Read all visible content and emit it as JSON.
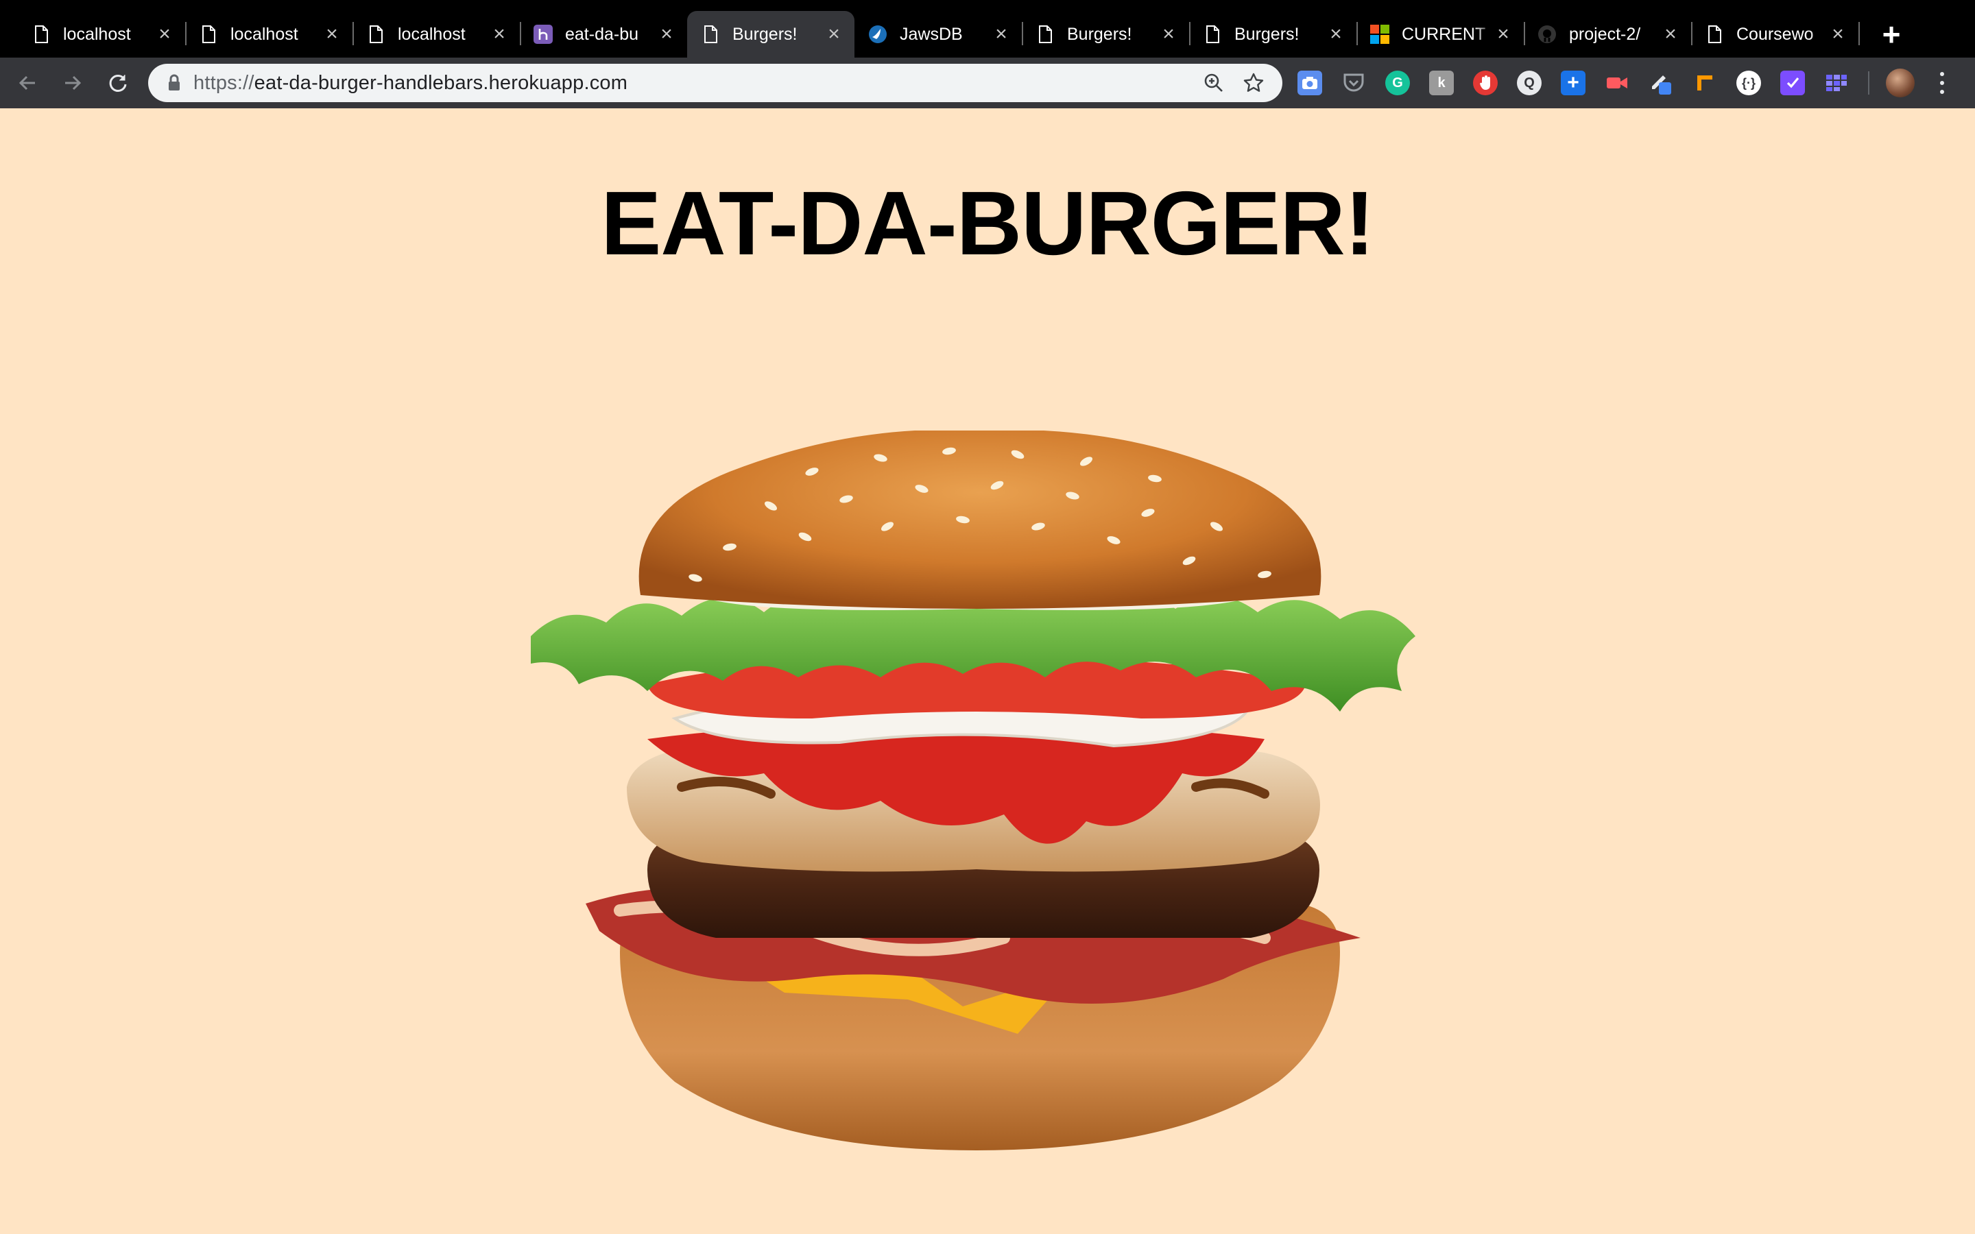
{
  "browser": {
    "tabs": [
      {
        "title": "localhost",
        "favicon": "page-icon",
        "active": false
      },
      {
        "title": "localhost",
        "favicon": "page-icon",
        "active": false
      },
      {
        "title": "localhost",
        "favicon": "page-icon",
        "active": false
      },
      {
        "title": "eat-da-bu",
        "favicon": "heroku-icon",
        "active": false
      },
      {
        "title": "Burgers!",
        "favicon": "page-icon",
        "active": true
      },
      {
        "title": "JawsDB",
        "favicon": "jawsdb-icon",
        "active": false
      },
      {
        "title": "Burgers!",
        "favicon": "page-icon",
        "active": false
      },
      {
        "title": "Burgers!",
        "favicon": "page-icon",
        "active": false
      },
      {
        "title": "CURRENT",
        "favicon": "microsoft-icon",
        "active": false
      },
      {
        "title": "project-2/",
        "favicon": "github-icon",
        "active": false
      },
      {
        "title": "Coursewo",
        "favicon": "page-icon",
        "active": false
      }
    ],
    "address": {
      "scheme": "https://",
      "host": "eat-da-burger-handlebars.herokuapp.com"
    },
    "extensions": [
      {
        "name": "screenshot-extension-icon",
        "color": "#5b8def"
      },
      {
        "name": "pocket-icon",
        "color": "#9aa0a6"
      },
      {
        "name": "grammarly-icon",
        "color": "#15c39a"
      },
      {
        "name": "extension-k-icon",
        "color": "#8a8a8a"
      },
      {
        "name": "stop-hand-icon",
        "color": "#e53935"
      },
      {
        "name": "extension-q-icon",
        "color": "#e8eaed"
      },
      {
        "name": "add-plus-icon",
        "color": "#1a73e8"
      },
      {
        "name": "video-record-icon",
        "color": "#ff5a5f"
      },
      {
        "name": "pen-edit-icon",
        "color": "#4285f4"
      },
      {
        "name": "ruler-measure-icon",
        "color": "#ff9800"
      },
      {
        "name": "code-braces-icon",
        "color": "#ffffff"
      },
      {
        "name": "checkbox-extension-icon",
        "color": "#7c4dff"
      },
      {
        "name": "grid-extension-icon",
        "color": "#6c63ff"
      }
    ]
  },
  "page": {
    "title": "EAT-DA-BURGER!",
    "background": "#ffe4c4",
    "image": "burger-photo"
  }
}
